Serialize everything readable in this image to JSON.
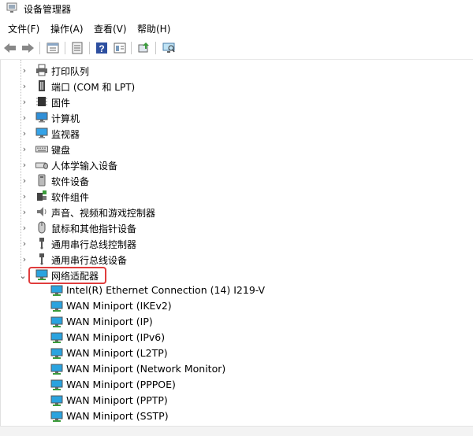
{
  "window": {
    "title": "设备管理器"
  },
  "menu": [
    "文件(F)",
    "操作(A)",
    "查看(V)",
    "帮助(H)"
  ],
  "toolbar": {
    "buttons": [
      "back-icon",
      "forward-icon",
      "device-list-icon",
      "properties-icon",
      "help-icon",
      "details-icon",
      "update-driver-icon",
      "scan-hardware-icon"
    ]
  },
  "tree": {
    "categories": [
      {
        "label": "打印队列",
        "icon": "printer-icon",
        "expanded": false
      },
      {
        "label": "端口 (COM 和 LPT)",
        "icon": "port-icon",
        "expanded": false
      },
      {
        "label": "固件",
        "icon": "firmware-icon",
        "expanded": false
      },
      {
        "label": "计算机",
        "icon": "computer-icon",
        "expanded": false
      },
      {
        "label": "监视器",
        "icon": "monitor-icon",
        "expanded": false
      },
      {
        "label": "键盘",
        "icon": "keyboard-icon",
        "expanded": false
      },
      {
        "label": "人体学输入设备",
        "icon": "hid-icon",
        "expanded": false
      },
      {
        "label": "软件设备",
        "icon": "software-device-icon",
        "expanded": false
      },
      {
        "label": "软件组件",
        "icon": "software-component-icon",
        "expanded": false
      },
      {
        "label": "声音、视频和游戏控制器",
        "icon": "speaker-icon",
        "expanded": false
      },
      {
        "label": "鼠标和其他指针设备",
        "icon": "mouse-icon",
        "expanded": false
      },
      {
        "label": "通用串行总线控制器",
        "icon": "usb-icon",
        "expanded": false
      },
      {
        "label": "通用串行总线设备",
        "icon": "usb-icon",
        "expanded": false
      },
      {
        "label": "网络适配器",
        "icon": "network-adapter-icon",
        "expanded": true
      }
    ],
    "network_children": [
      "Intel(R) Ethernet Connection (14) I219-V",
      "WAN Miniport (IKEv2)",
      "WAN Miniport (IP)",
      "WAN Miniport (IPv6)",
      "WAN Miniport (L2TP)",
      "WAN Miniport (Network Monitor)",
      "WAN Miniport (PPPOE)",
      "WAN Miniport (PPTP)",
      "WAN Miniport (SSTP)"
    ]
  }
}
